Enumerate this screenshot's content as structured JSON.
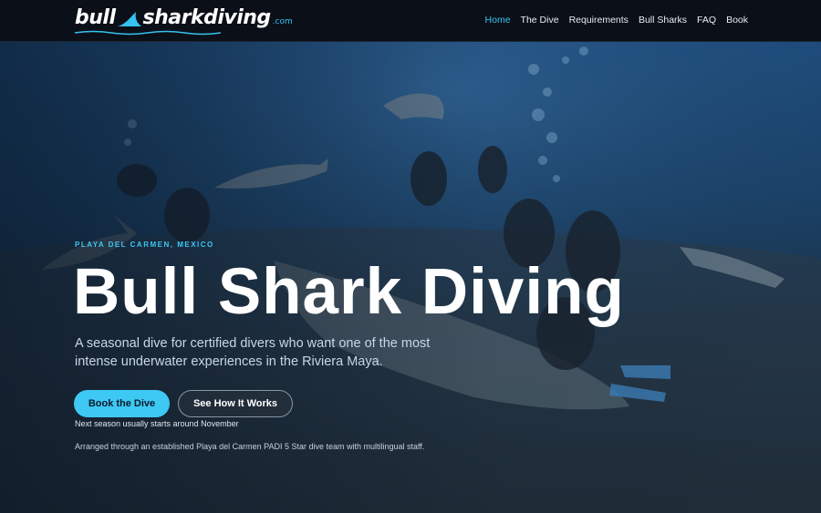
{
  "brand": {
    "logo_part1": "bull",
    "logo_part2": "sharkdiving",
    "logo_tld": ".com"
  },
  "nav": {
    "items": [
      {
        "label": "Home",
        "active": true
      },
      {
        "label": "The Dive",
        "active": false
      },
      {
        "label": "Requirements",
        "active": false
      },
      {
        "label": "Bull Sharks",
        "active": false
      },
      {
        "label": "FAQ",
        "active": false
      },
      {
        "label": "Book",
        "active": false
      }
    ]
  },
  "hero": {
    "eyebrow": "PLAYA DEL CARMEN, MEXICO",
    "title": "Bull Shark Diving",
    "subtitle": "A seasonal dive for certified divers who want one of the most intense underwater experiences in the Riviera Maya.",
    "primary_button": "Book the Dive",
    "secondary_button": "See How It Works",
    "season_note": "Next season usually starts around November",
    "footer_note": "Arranged through an established Playa del Carmen PADI 5 Star dive team with multilingual staff.",
    "background_icon": "underwater-divers-sharks-photo"
  },
  "colors": {
    "accent": "#3ec8f4",
    "nav_bg": "#0b0f18",
    "text": "#ffffff"
  }
}
